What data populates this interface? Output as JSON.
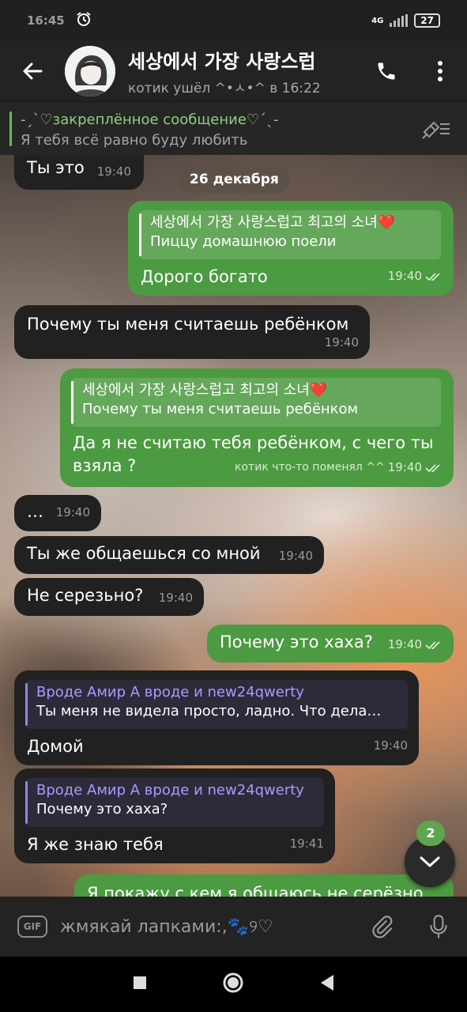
{
  "status_bar": {
    "time": "16:45",
    "network": "4G",
    "battery": "27"
  },
  "header": {
    "title": "세상에서 가장 사랑스럽",
    "status": "котик ушёл ^•ㅅ•^ в 16:22"
  },
  "pinned": {
    "title": "-ˏˋ♡закреплённое сообщение♡ˊˎ-",
    "text": "Я тебя всё равно буду любить"
  },
  "date_divider": "26 декабря",
  "messages": [
    {
      "dir": "in",
      "text": "Ты это",
      "time": "19:40"
    },
    {
      "dir": "out",
      "reply_name": "세상에서 가장 사랑스럽고 최고의 소녀❤️",
      "reply_text": "Пиццу домашнюю поели",
      "text": "Дорого богато",
      "time": "19:40"
    },
    {
      "dir": "in",
      "text": "Почему ты меня считаешь ребёнком",
      "time": "19:40"
    },
    {
      "dir": "out",
      "reply_name": "세상에서 가장 사랑스럽고 최고의 소녀❤️",
      "reply_text": "Почему ты меня считаешь ребёнком",
      "text": "Да я не считаю тебя ребёнком, с чего ты взяла ?",
      "edited": "котик что-то поменял ^^",
      "time": "19:40"
    },
    {
      "dir": "in",
      "text": "…",
      "time": "19:40"
    },
    {
      "dir": "in",
      "text": "Ты же общаешься со мной",
      "time": "19:40"
    },
    {
      "dir": "in",
      "text": "Не серезьно?",
      "time": "19:40"
    },
    {
      "dir": "out",
      "text": "Почему это хаха?",
      "time": "19:40"
    },
    {
      "dir": "in",
      "reply_name": "Вроде Амир А вроде и new24qwerty",
      "reply_text": "Ты меня не видела просто, ладно. Что дела…",
      "text": "Домой",
      "time": "19:40"
    },
    {
      "dir": "in",
      "reply_name": "Вроде Амир А вроде и new24qwerty",
      "reply_text": "Почему это хаха?",
      "text": "Я же знаю тебя",
      "time": "19:41"
    },
    {
      "dir": "out",
      "text": "Я покажу с кем я общаюсь не серёзно"
    }
  ],
  "scroll_badge": "2",
  "input": {
    "placeholder": "жмякай лапками:,🐾୨♡",
    "gif_label": "GIF"
  },
  "colors": {
    "outgoing": "#4c9a41",
    "incoming": "#212121",
    "accent": "#69b85d"
  }
}
